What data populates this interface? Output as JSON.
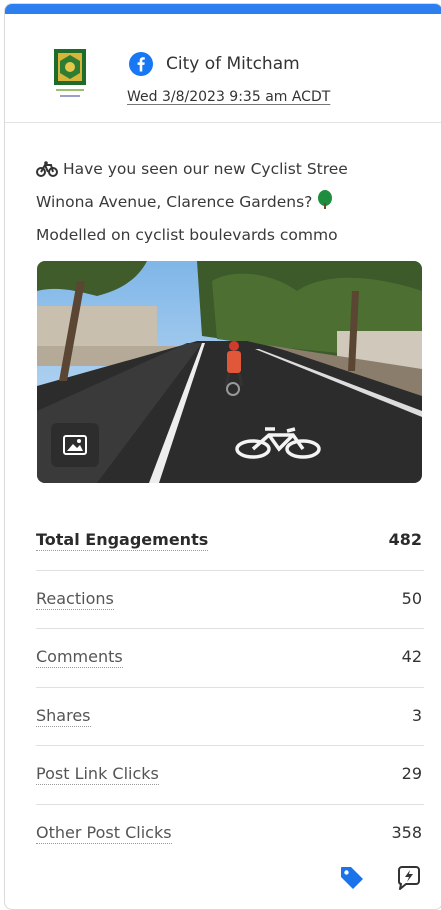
{
  "colors": {
    "accent": "#2d7ff0",
    "facebook": "#1877f2",
    "tag": "#1a73e8"
  },
  "post": {
    "page_name": "City of Mitcham",
    "date": "Wed 3/8/2023 9:35 am ACDT",
    "text_lines": [
      "Have you seen our new Cyclist Stree",
      "Winona Avenue, Clarence Gardens?",
      "Modelled on cyclist boulevards commo"
    ],
    "image_alt_icon": "image-icon"
  },
  "metrics": [
    {
      "label": "Total Engagements",
      "value": "482",
      "bold": true
    },
    {
      "label": "Reactions",
      "value": "50"
    },
    {
      "label": "Comments",
      "value": "42"
    },
    {
      "label": "Shares",
      "value": "3"
    },
    {
      "label": "Post Link Clicks",
      "value": "29"
    },
    {
      "label": "Other Post Clicks",
      "value": "358"
    }
  ],
  "footer": {
    "icons": [
      "tag-icon",
      "boost-icon"
    ]
  }
}
